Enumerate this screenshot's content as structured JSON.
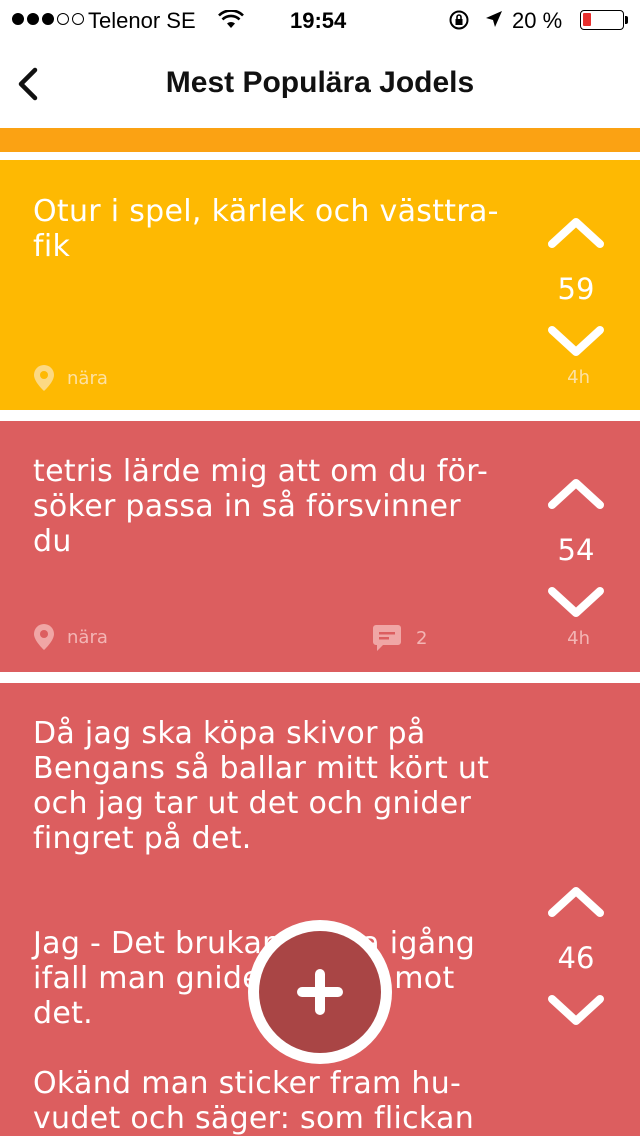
{
  "status_bar": {
    "carrier": "Telenor SE",
    "time": "19:54",
    "battery_percent": "20 %",
    "battery_level": 0.2,
    "signal_bars": 3
  },
  "nav": {
    "title": "Mest Populära Jodels",
    "back_icon": "chevron-left-icon"
  },
  "colors": {
    "orange_peek": "#fba213",
    "yellow_post": "#feb902",
    "red_post": "#dc5e5f",
    "fab": "#a94545"
  },
  "posts": [
    {
      "text": "Otur i spel, kärlek och västtra-\nfik",
      "votes": "59",
      "location": "nära",
      "time": "4h",
      "color": "#feb902"
    },
    {
      "text": "tetris lärde mig att om du för-\nsöker passa in så försvinner\ndu",
      "votes": "54",
      "location": "nära",
      "comments": "2",
      "time": "4h",
      "color": "#dc5e5f"
    },
    {
      "text": "Då jag ska köpa skivor på\nBengans så ballar mitt kört ut\noch jag tar ut det och gnider\nfingret på det.\n\n\nJag - Det brukar hoppa igång\nifall man gnider fingret mot\ndet.\n\nOkänd man sticker fram hu-\nvudet och säger: som flickan\nsa!",
      "votes": "46",
      "color": "#dc5e5f"
    }
  ]
}
